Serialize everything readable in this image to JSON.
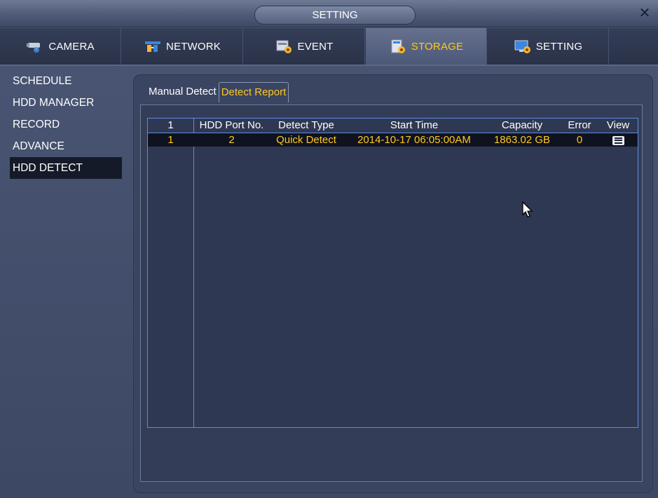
{
  "window": {
    "title": "SETTING"
  },
  "tabs": [
    {
      "label": "CAMERA",
      "icon": "camera-icon",
      "active": false
    },
    {
      "label": "NETWORK",
      "icon": "network-icon",
      "active": false
    },
    {
      "label": "EVENT",
      "icon": "event-icon",
      "active": false
    },
    {
      "label": "STORAGE",
      "icon": "storage-icon",
      "active": true
    },
    {
      "label": "SETTING",
      "icon": "setting-icon",
      "active": false
    }
  ],
  "sidebar": {
    "items": [
      {
        "label": "SCHEDULE"
      },
      {
        "label": "HDD MANAGER"
      },
      {
        "label": "RECORD"
      },
      {
        "label": "ADVANCE"
      },
      {
        "label": "HDD DETECT",
        "active": true
      }
    ]
  },
  "subtabs": [
    {
      "label": "Manual Detect",
      "active": false
    },
    {
      "label": "Detect Report",
      "active": true
    }
  ],
  "report_table": {
    "columns": [
      "1",
      "HDD Port No.",
      "Detect Type",
      "Start Time",
      "Capacity",
      "Error",
      "View"
    ],
    "rows": [
      {
        "index": "1",
        "port": "2",
        "type": "Quick Detect",
        "start": "2014-10-17 06:05:00AM",
        "capacity": "1863.02 GB",
        "error": "0",
        "view_icon": "list-icon"
      }
    ]
  },
  "colors": {
    "accent": "#ffc81e",
    "selected_row": "#0f1320",
    "table_border": "#5d8ce0"
  }
}
